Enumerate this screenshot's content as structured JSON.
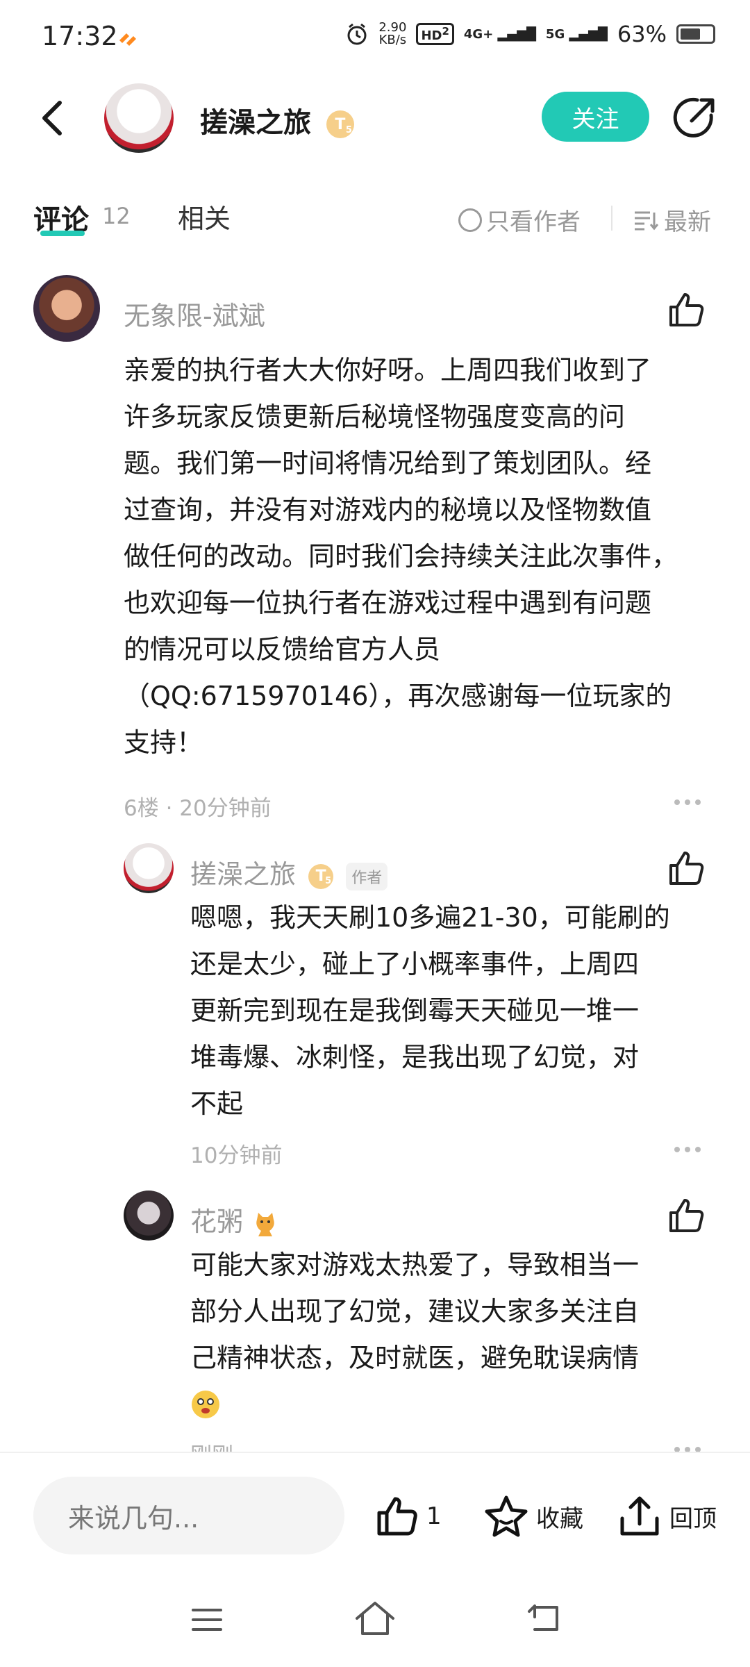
{
  "status_bar": {
    "time": "17:32",
    "speed_top": "2.90",
    "speed_unit": "KB/s",
    "hd": "HD",
    "hd_sub": "2",
    "net1": "4G+",
    "net2": "5G",
    "battery": "63%",
    "battery_level": 0.63
  },
  "header": {
    "title": "搓澡之旅",
    "level": "T",
    "level_sub": "5",
    "follow_label": "关注"
  },
  "tabs": {
    "comment_label": "评论",
    "comment_count": "12",
    "related_label": "相关",
    "only_author_label": "只看作者",
    "sort_label": "最新"
  },
  "comments": [
    {
      "username": "无象限-斌斌",
      "text_lines": [
        "亲爱的执行者大大你好呀。上周四我们收到了",
        "许多玩家反馈更新后秘境怪物强度变高的问",
        "题。我们第一时间将情况给到了策划团队。经",
        "过查询，并没有对游戏内的秘境以及怪物数值",
        "做任何的改动。同时我们会持续关注此次事件，",
        "也欢迎每一位执行者在游戏过程中遇到有问题",
        "的情况可以反馈给官方人员",
        "（QQ:6715970146），再次感谢每一位玩家的",
        "支持！"
      ],
      "meta": "6楼 · 20分钟前"
    }
  ],
  "replies": [
    {
      "username": "搓澡之旅",
      "level": "T",
      "level_sub": "5",
      "author_tag": "作者",
      "text_lines": [
        "嗯嗯，我天天刷10多遍21-30，可能刷的",
        "还是太少，碰上了小概率事件，上周四",
        "更新完到现在是我倒霉天天碰见一堆一",
        "堆毒爆、冰刺怪，是我出现了幻觉，对",
        "不起"
      ],
      "meta": "10分钟前"
    },
    {
      "username": "花粥",
      "text_lines": [
        "可能大家对游戏太热爱了，导致相当一",
        "部分人出现了幻觉，建议大家多关注自",
        "己精神状态，及时就医，避免耽误病情"
      ],
      "meta": "刚刚"
    }
  ],
  "bottom_bar": {
    "input_placeholder": "来说几句...",
    "like_count": "1",
    "favorite_label": "收藏",
    "top_label": "回顶"
  },
  "colors": {
    "accent": "#22c9b5",
    "muted": "#999999",
    "badge": "#f6cf8a"
  }
}
